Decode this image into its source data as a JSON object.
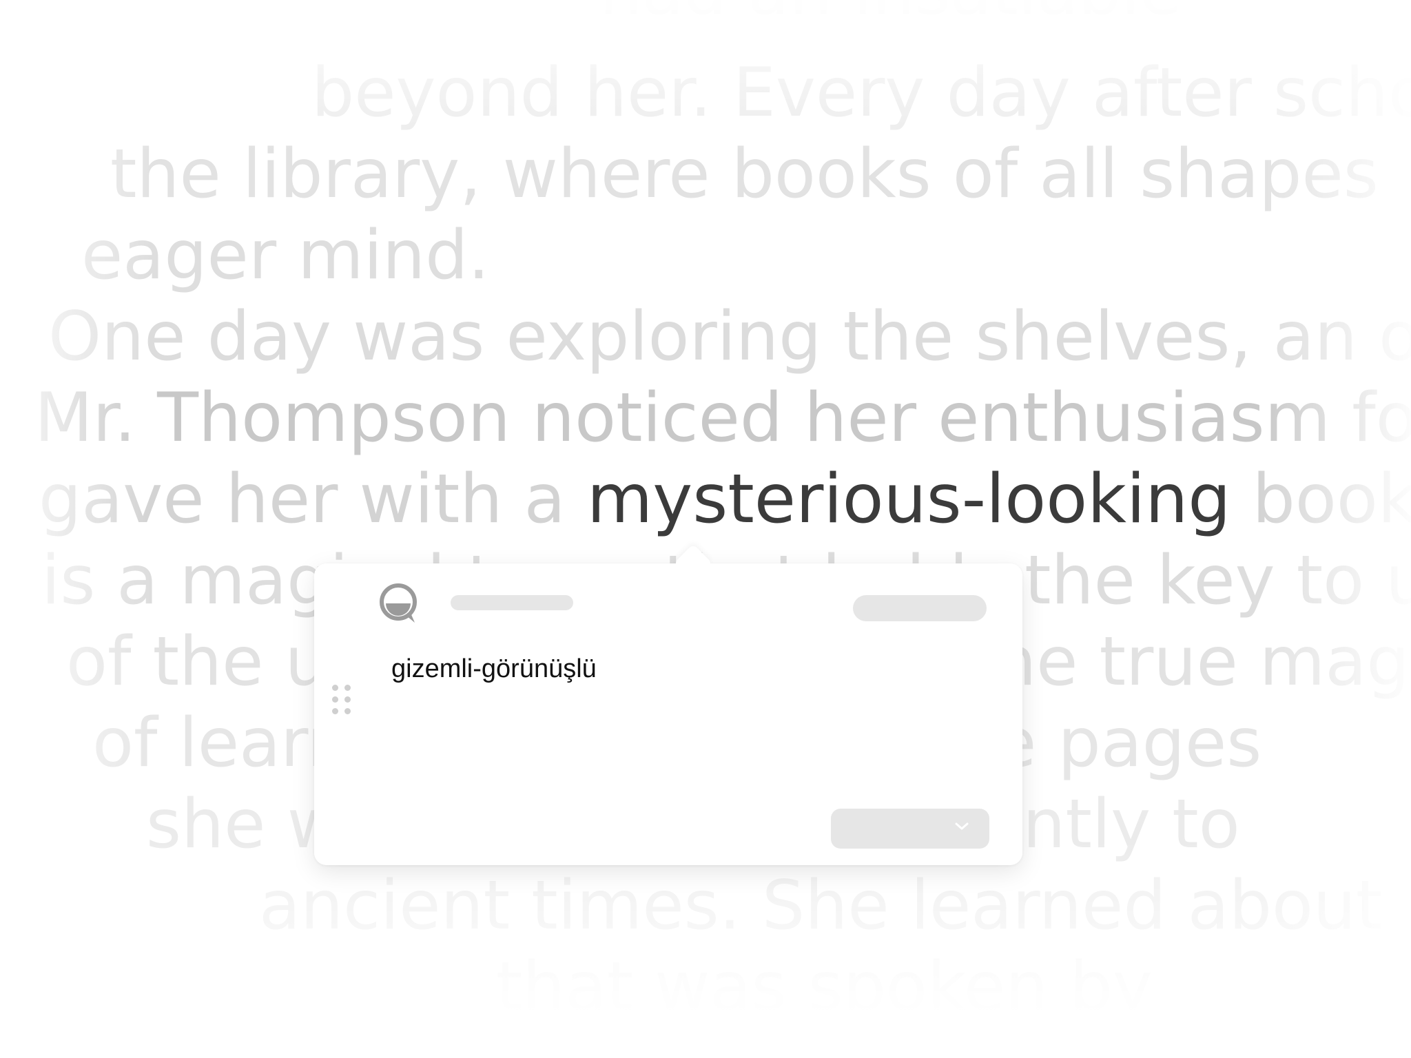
{
  "background_color": "#ffffff",
  "text_lines": [
    {
      "segments": [
        {
          "text": "had an insatiable",
          "color": "#f2f2f2"
        }
      ]
    },
    {
      "segments": [
        {
          "text": "beyond her. Every day after school",
          "color": "#ebebeb"
        }
      ]
    },
    {
      "segments": [
        {
          "text": "the library, where books of all shapes",
          "color": "#e2e2e2"
        }
      ]
    },
    {
      "segments": [
        {
          "text": "eager mind.",
          "color": "#dedede"
        }
      ]
    },
    {
      "segments": [
        {
          "text": "One day was exploring the shelves, an old librarian",
          "color": "#dcdcdc"
        }
      ]
    },
    {
      "segments": [
        {
          "text": "Mr. Thompson noticed her enthusiasm for learning",
          "color": "#c8c8c8"
        }
      ]
    },
    {
      "segments": [
        {
          "text": "gave her with a ",
          "color": "#d3d3d3"
        },
        {
          "text": "mysterious-looking",
          "color": "#3b3b3b",
          "highlight": true
        },
        {
          "text": " book and said",
          "color": "#d3d3d3"
        }
      ]
    },
    {
      "segments": [
        {
          "text": "is a magical tome that holds the key to unlocking",
          "color": "#dddddd"
        }
      ]
    },
    {
      "segments": [
        {
          "text": "of the universe... discover the true magic",
          "color": "#e2e2e2"
        }
      ]
    },
    {
      "segments": [
        {
          "text": "of learning... she turned the pages",
          "color": "#e6e6e6"
        }
      ]
    },
    {
      "segments": [
        {
          "text": "she was transported instantly to",
          "color": "#ebebeb"
        }
      ]
    },
    {
      "segments": [
        {
          "text": "ancient times. She learned about",
          "color": "#efefef"
        }
      ]
    },
    {
      "segments": [
        {
          "text": "that was spoken by",
          "color": "#f4f4f4"
        }
      ]
    }
  ],
  "popup": {
    "translation": "gizemli-görünüşlü",
    "icons": {
      "logo": "translator-logo-icon",
      "drag": "drag-handle-icon",
      "chevron": "chevron-down-icon"
    },
    "placeholder_color": "#e6e6e6"
  }
}
